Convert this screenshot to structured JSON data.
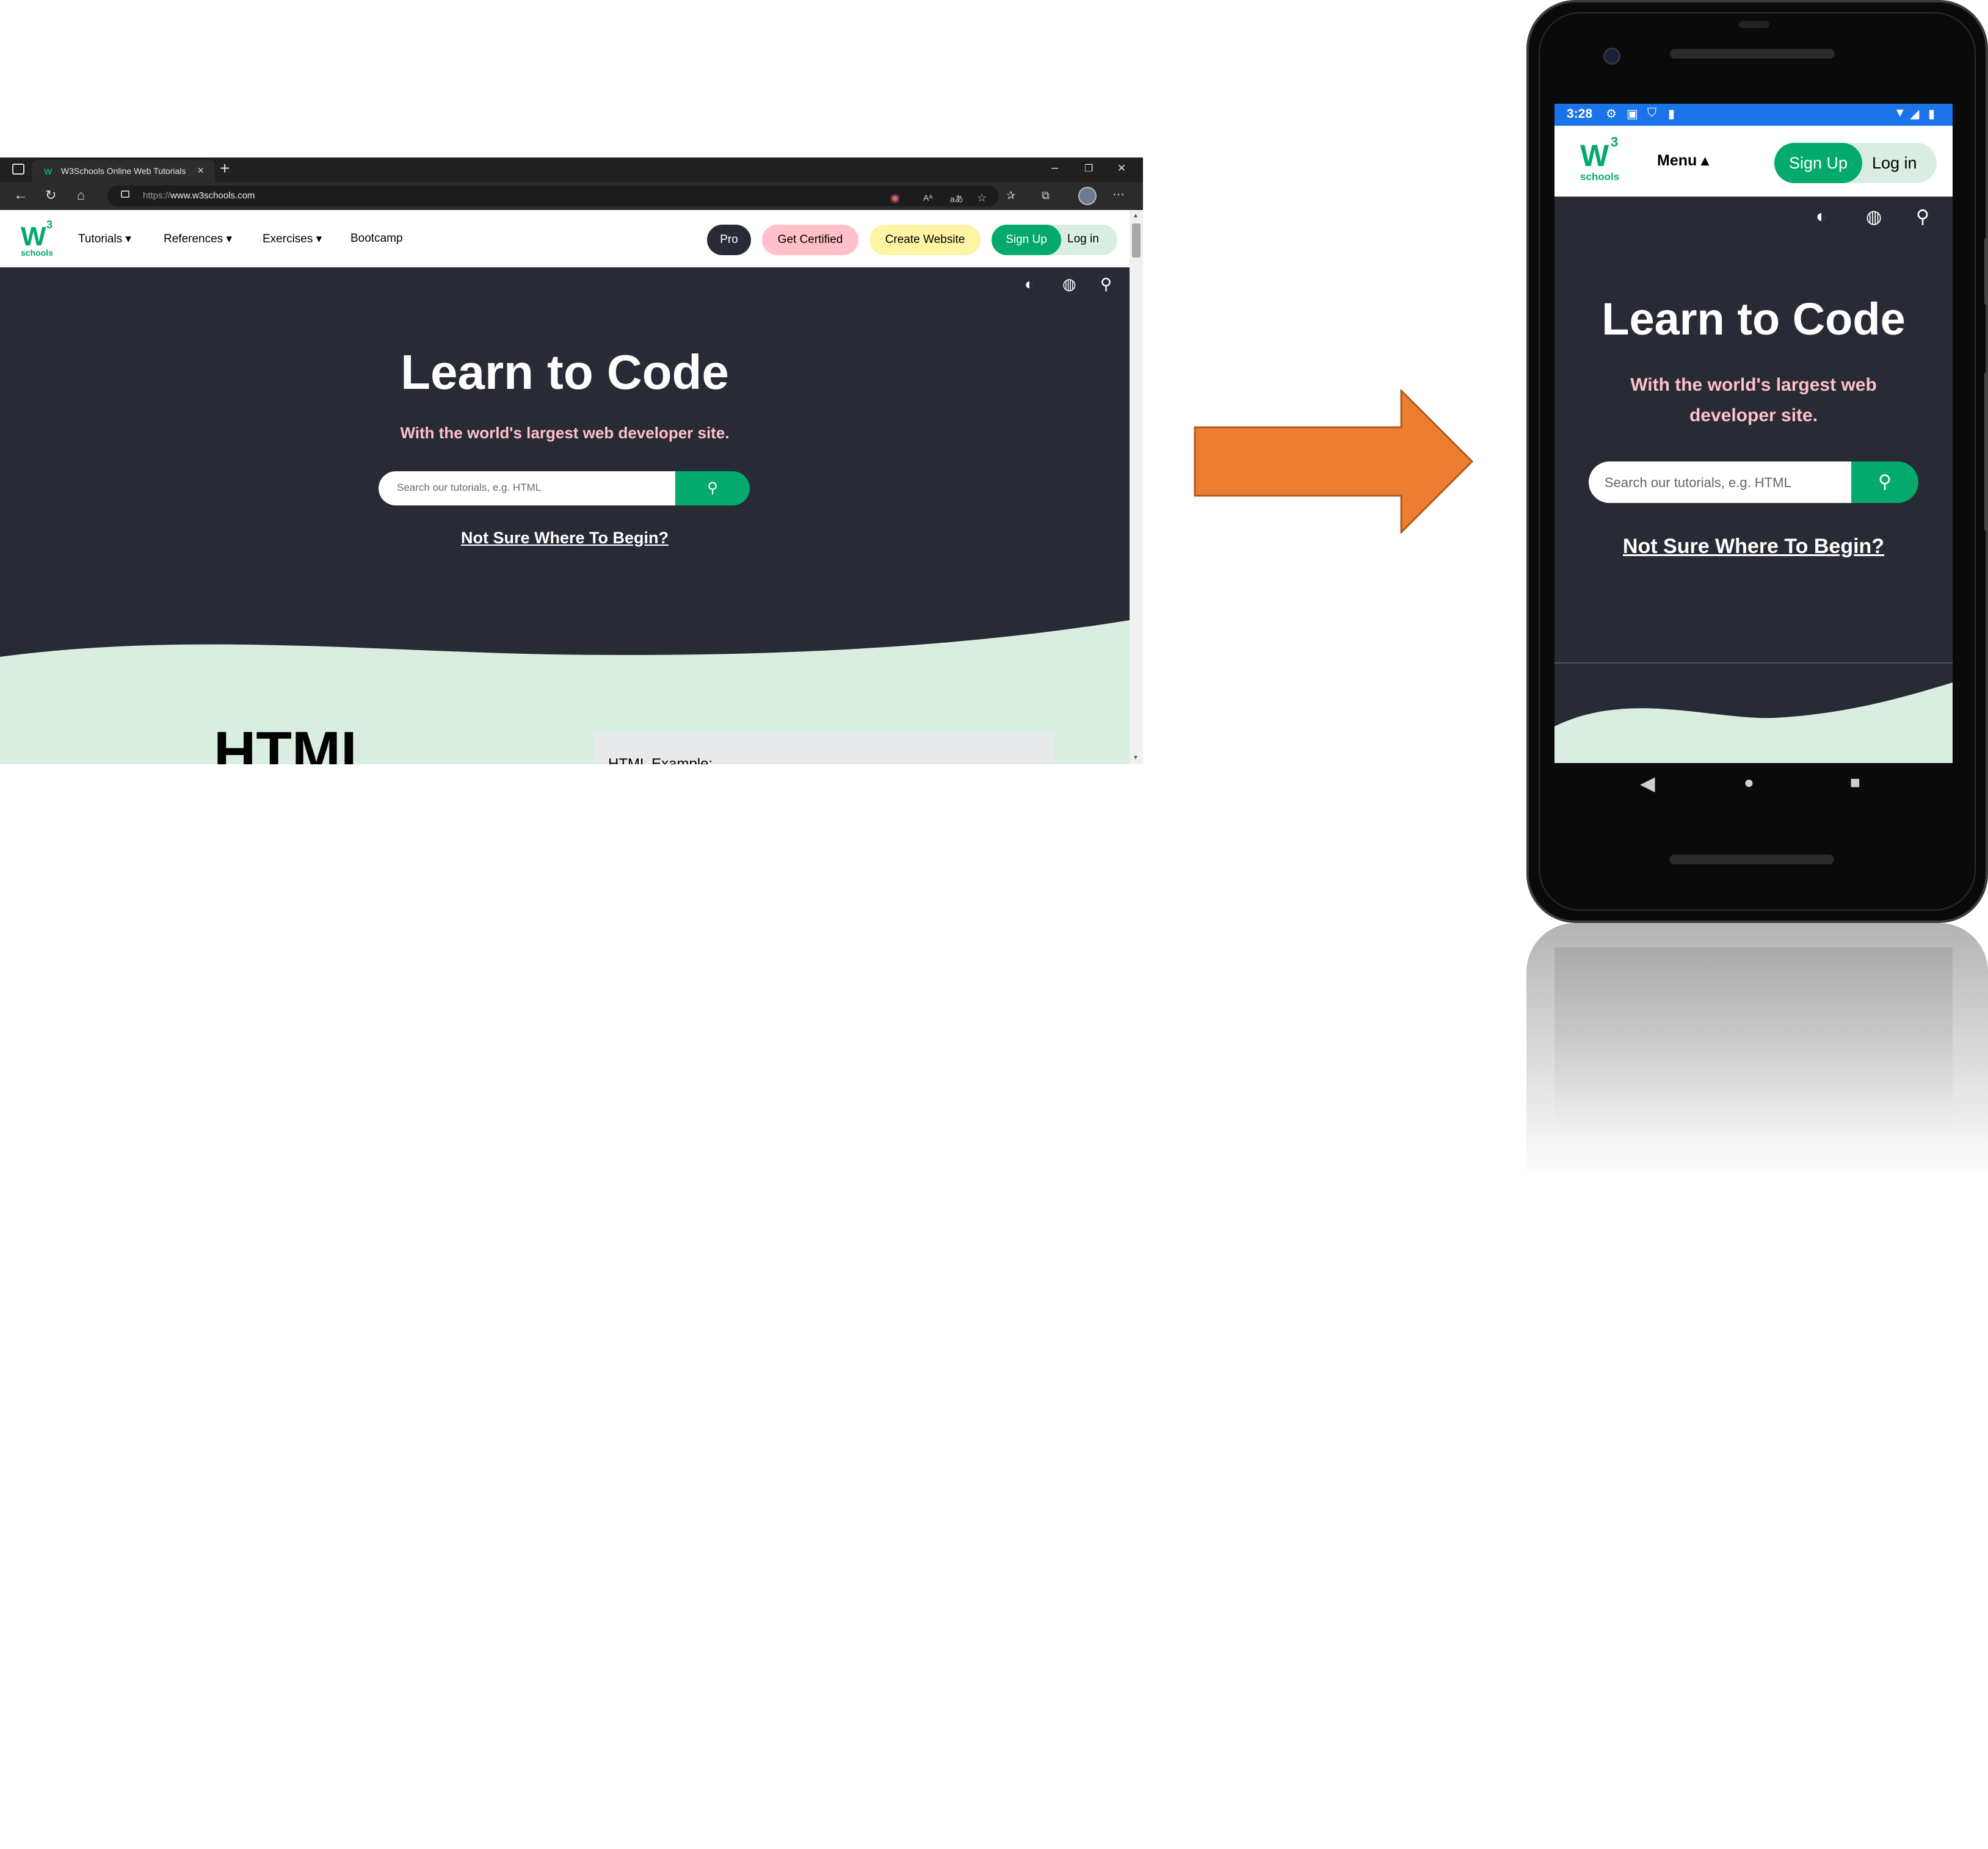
{
  "desktop": {
    "tab": {
      "title": "W3Schools Online Web Tutorials",
      "favicon": "W",
      "close": "×",
      "new_tab": "+"
    },
    "window_controls": {
      "minimize": "–",
      "restore": "❐",
      "close": "✕"
    },
    "address": {
      "scheme": "https://",
      "host": "www.w3schools.com"
    },
    "nav": {
      "logo_w": "W",
      "logo_3": "3",
      "logo_schools": "schools",
      "links": [
        "Tutorials ▾",
        "References ▾",
        "Exercises ▾",
        "Bootcamp"
      ],
      "pro": "Pro",
      "get_certified": "Get Certified",
      "create_website": "Create Website",
      "sign_up": "Sign Up",
      "log_in": "Log in"
    },
    "hero": {
      "title": "Learn to Code",
      "subtitle": "With the world's largest web developer site.",
      "search_placeholder": "Search our tutorials, e.g. HTML",
      "link": "Not Sure Where To Begin?"
    },
    "section": {
      "heading": "HTML",
      "example_title": "HTML Example:"
    },
    "colors": {
      "brand_green": "#04aa6d",
      "hero_bg": "#282a35",
      "subtitle_pink": "#ffc0c7",
      "wave": "#d9eee1",
      "pro_bg": "#282a35",
      "certified_bg": "#ffc0c7",
      "website_bg": "#fff4a3"
    },
    "icons": [
      "contrast-icon",
      "globe-icon",
      "search-icon"
    ]
  },
  "phone": {
    "status": {
      "time": "3:28"
    },
    "nav": {
      "logo_w": "W",
      "logo_3": "3",
      "logo_schools": "schools",
      "menu": "Menu ▴",
      "sign_up": "Sign Up",
      "log_in": "Log in"
    },
    "hero": {
      "title": "Learn to Code",
      "subtitle": "With the world's largest web developer site.",
      "search_placeholder": "Search our tutorials, e.g. HTML",
      "link": "Not Sure Where To Begin?"
    },
    "softkeys": [
      "◀",
      "●",
      "■"
    ]
  },
  "arrow_color": "#ed7d31"
}
